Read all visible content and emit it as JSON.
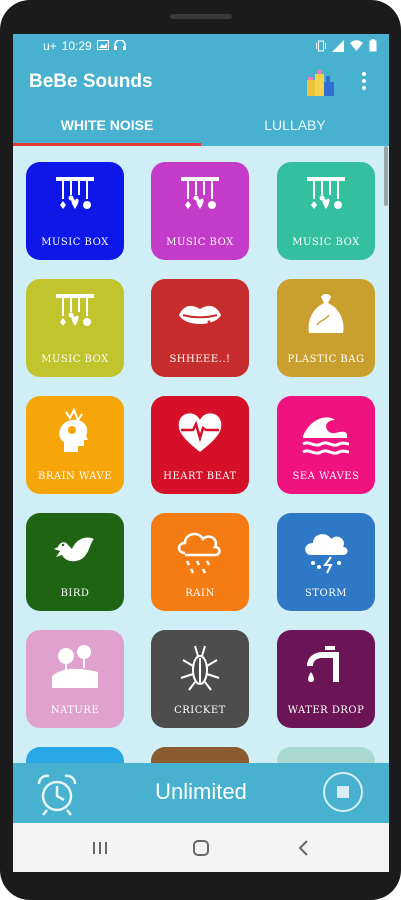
{
  "status_bar": {
    "time": "10:29",
    "carrier_icon": "u+"
  },
  "app": {
    "title": "BeBe Sounds"
  },
  "tabs": [
    {
      "label": "WHITE NOISE",
      "selected": true
    },
    {
      "label": "LULLABY",
      "selected": false
    }
  ],
  "sounds": [
    {
      "label": "MUSIC BOX",
      "color": "#0d17e8",
      "icon": "music-box-icon"
    },
    {
      "label": "MUSIC BOX",
      "color": "#c43bc9",
      "icon": "music-box-icon"
    },
    {
      "label": "MUSIC BOX",
      "color": "#34c09e",
      "icon": "music-box-icon"
    },
    {
      "label": "MUSIC BOX",
      "color": "#c1c42c",
      "icon": "music-box-icon"
    },
    {
      "label": "SHHEEE..!",
      "color": "#c72d2d",
      "icon": "lips-icon"
    },
    {
      "label": "PLASTIC BAG",
      "color": "#c9a02e",
      "icon": "plastic-bag-icon"
    },
    {
      "label": "BRAIN WAVE",
      "color": "#f7a60a",
      "icon": "brain-wave-icon"
    },
    {
      "label": "HEART BEAT",
      "color": "#d7102a",
      "icon": "heart-beat-icon"
    },
    {
      "label": "SEA WAVES",
      "color": "#f0127f",
      "icon": "sea-waves-icon"
    },
    {
      "label": "BIRD",
      "color": "#1f6413",
      "icon": "bird-icon"
    },
    {
      "label": "RAIN",
      "color": "#f57c13",
      "icon": "rain-icon"
    },
    {
      "label": "STORM",
      "color": "#2f78c6",
      "icon": "storm-icon"
    },
    {
      "label": "NATURE",
      "color": "#e0a1ce",
      "icon": "nature-icon"
    },
    {
      "label": "CRICKET",
      "color": "#4d4d4d",
      "icon": "cricket-icon"
    },
    {
      "label": "WATER DROP",
      "color": "#6b1556",
      "icon": "water-drop-icon"
    },
    {
      "label": "",
      "color": "#27a7e6",
      "icon": ""
    },
    {
      "label": "",
      "color": "#8c5a2f",
      "icon": ""
    },
    {
      "label": "",
      "color": "#a9d9cf",
      "icon": ""
    }
  ],
  "bottom_bar": {
    "timer_text": "Unlimited"
  }
}
